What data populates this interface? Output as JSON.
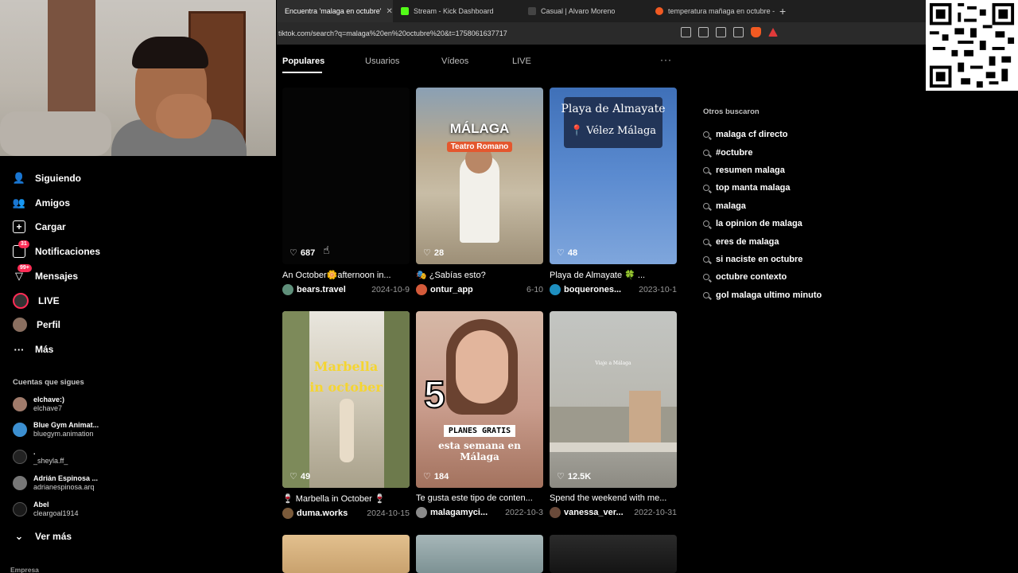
{
  "browser": {
    "tabs": [
      {
        "label": "Encuentra 'malaga en octubre'",
        "active": true,
        "favicon_color": "#ffffff"
      },
      {
        "label": "Stream - Kick Dashboard",
        "active": false,
        "favicon_color": "#53fc18"
      },
      {
        "label": "Casual | Alvaro Moreno",
        "active": false,
        "favicon_color": "#444444"
      },
      {
        "label": "temperatura mañaga en octubre - B",
        "active": false,
        "favicon_color": "#f15a22"
      }
    ],
    "new_tab": "+",
    "close_tab": "✕",
    "url": "tiktok.com/search?q=malaga%20en%20octubre%20&t=1758061637717"
  },
  "sidebar": {
    "nav": [
      {
        "label": "Siguiendo",
        "icon": "following-icon"
      },
      {
        "label": "Amigos",
        "icon": "friends-icon"
      },
      {
        "label": "Cargar",
        "icon": "upload-icon"
      },
      {
        "label": "Notificaciones",
        "icon": "notifications-icon",
        "badge": "31"
      },
      {
        "label": "Mensajes",
        "icon": "messages-icon",
        "badge": "99+"
      },
      {
        "label": "LIVE",
        "icon": "live-icon"
      },
      {
        "label": "Perfil",
        "icon": "profile-icon"
      },
      {
        "label": "Más",
        "icon": "more-icon"
      }
    ],
    "following_title": "Cuentas que sigues",
    "following": [
      {
        "name": "elchave:)",
        "handle": "elchave7",
        "color": "#a07b6b"
      },
      {
        "name": "Blue Gym Animat...",
        "handle": "bluegym.animation",
        "color": "#3c8fd0"
      },
      {
        "name": ".",
        "handle": "_sheyla.ff_",
        "color": "#222222"
      },
      {
        "name": "Adrián Espinosa ...",
        "handle": "adrianespinosa.arq",
        "color": "#777777"
      },
      {
        "name": "Abel",
        "handle": "cleargoal1914",
        "color": "#1a1a1a"
      }
    ],
    "see_more": "Ver más",
    "footer": "Empresa"
  },
  "main": {
    "tabs": [
      "Populares",
      "Usuarios",
      "Vídeos",
      "LIVE"
    ],
    "more": "···",
    "videos": [
      {
        "likes": "687",
        "caption": "An October🌼afternoon in...",
        "user": "bears.travel",
        "date": "2024-10-9",
        "thumb_color": "#050505",
        "av_color": "#5f8f7a"
      },
      {
        "likes": "28",
        "caption": "🎭 ¿Sabías esto?",
        "user": "ontur_app",
        "date": "6-10",
        "thumb_color": "#a39a85",
        "overlay_title": "MÁLAGA",
        "overlay_sub": "Teatro Romano",
        "av_color": "#d45a3a"
      },
      {
        "likes": "48",
        "caption": "Playa de Almayate 🍀 ...",
        "user": "boquerones...",
        "date": "2023-10-1",
        "thumb_color": "#4f7fc4",
        "overlay_title": "Playa de Almayate",
        "overlay_sub": "📍 Vélez Málaga",
        "av_color": "#1e8fc0"
      },
      {
        "likes": "49",
        "caption": "🍷 Marbella in October 🍷",
        "user": "duma.works",
        "date": "2024-10-15",
        "thumb_color": "#c9c4b4",
        "overlay_title": "Marbella",
        "overlay_sub": "in october",
        "av_color": "#7a5a3a"
      },
      {
        "likes": "184",
        "caption": "Te gusta este tipo de conten...",
        "user": "malagamyci...",
        "date": "2022-10-3",
        "thumb_color": "#c99c8c",
        "overlay_big": "5",
        "overlay_title": "PLANES GRATIS",
        "overlay_sub": "esta semana en Málaga",
        "av_color": "#8a8a8a"
      },
      {
        "likes": "12.5K",
        "caption": "Spend the weekend with me...",
        "user": "vanessa_ver...",
        "date": "2022-10-31",
        "thumb_color": "#b7b5ae",
        "overlay_title": "Viaje a Málaga",
        "av_color": "#6a4a3a"
      },
      {
        "thumb_color": "#d6b582"
      },
      {
        "thumb_color": "#8fa3a6"
      },
      {
        "thumb_color": "#232323"
      }
    ]
  },
  "related": {
    "title": "Otros buscaron",
    "items": [
      "malaga cf directo",
      "#octubre",
      "resumen malaga",
      "top manta malaga",
      "malaga",
      "la opinion de malaga",
      "eres de malaga",
      "si naciste en octubre",
      "octubre contexto",
      "gol malaga ultimo minuto"
    ]
  }
}
